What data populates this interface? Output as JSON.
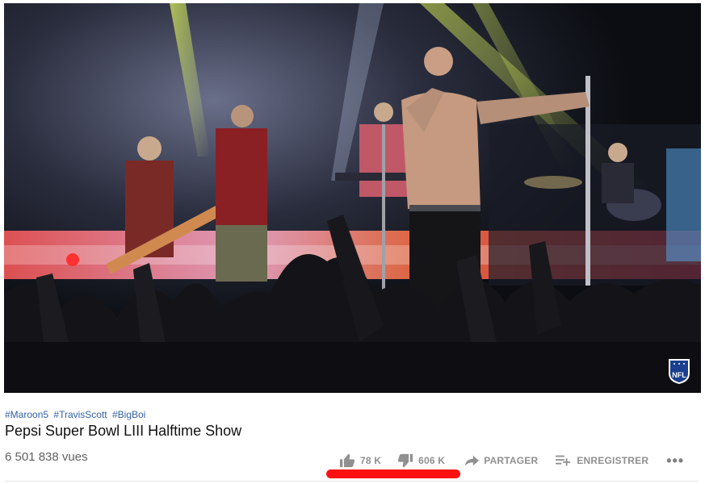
{
  "video": {
    "player_bg": "#0b0d12",
    "badge_icon": "nfl-shield-icon",
    "badge_text": "NFL"
  },
  "hashtags": [
    "#Maroon5",
    "#TravisScott",
    "#BigBoi"
  ],
  "title": "Pepsi Super Bowl LIII Halftime Show",
  "views": "6 501 838 vues",
  "actions": {
    "like_count": "78 K",
    "dislike_count": "606 K",
    "share_label": "PARTAGER",
    "save_label": "ENREGISTRER",
    "more_label": "•••",
    "like_icon": "thumbs-up-icon",
    "dislike_icon": "thumbs-down-icon",
    "share_icon": "share-arrow-icon",
    "save_icon": "playlist-add-icon"
  },
  "colors": {
    "hashtag": "#3362a6",
    "title": "#111111",
    "meta": "#606060",
    "action": "#909090",
    "highlight": "#ff1010"
  }
}
